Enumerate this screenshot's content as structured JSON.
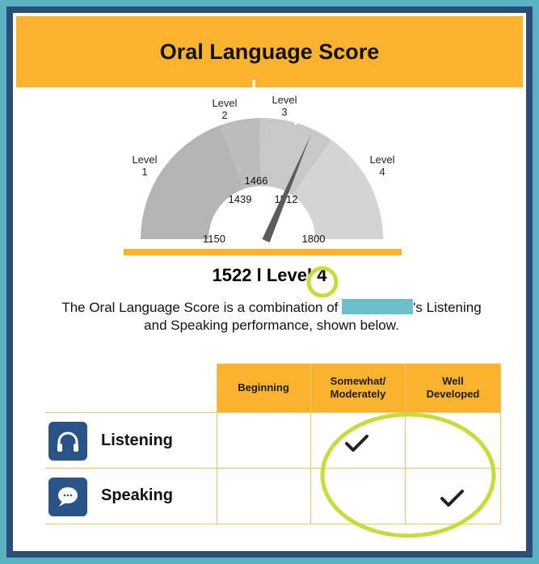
{
  "title": "Oral Language Score",
  "gauge": {
    "min": 1150,
    "max": 1800,
    "score": 1522,
    "levels": [
      {
        "line1": "Level",
        "line2": "1"
      },
      {
        "line1": "Level",
        "line2": "2"
      },
      {
        "line1": "Level",
        "line2": "3"
      },
      {
        "line1": "Level",
        "line2": "4"
      }
    ],
    "cutpoints": [
      "1439",
      "1466",
      "1512"
    ],
    "min_label": "1150",
    "max_label": "1800",
    "colors": {
      "level1": "#b4b4b4",
      "level2": "#bcbcbc",
      "level3": "#c8c8c8",
      "level4": "#d4d4d4",
      "needle": "#5b5b5b",
      "bar": "#fbb32d"
    }
  },
  "score_text": {
    "score": "1522",
    "separator": "l",
    "level_word": "Level",
    "level_number": "4"
  },
  "description": {
    "before_name": "The Oral Language Score is a combination of",
    "after_name": "'s Listening",
    "line2": "and Speaking performance, shown below."
  },
  "table": {
    "columns": [
      {
        "line1": "Beginning",
        "line2": ""
      },
      {
        "line1": "Somewhat/",
        "line2": "Moderately"
      },
      {
        "line1": "Well",
        "line2": "Developed"
      }
    ],
    "rows": [
      {
        "label": "Listening",
        "icon": "headphones-icon",
        "checked_column": 1
      },
      {
        "label": "Speaking",
        "icon": "speech-bubble-icon",
        "checked_column": 2
      }
    ]
  },
  "colors": {
    "accent": "#fbb32d",
    "frame": "#2c4c79",
    "outer": "#5ab3c4",
    "icon_bg": "#2a5487",
    "annotation": "#c7dc3a"
  }
}
